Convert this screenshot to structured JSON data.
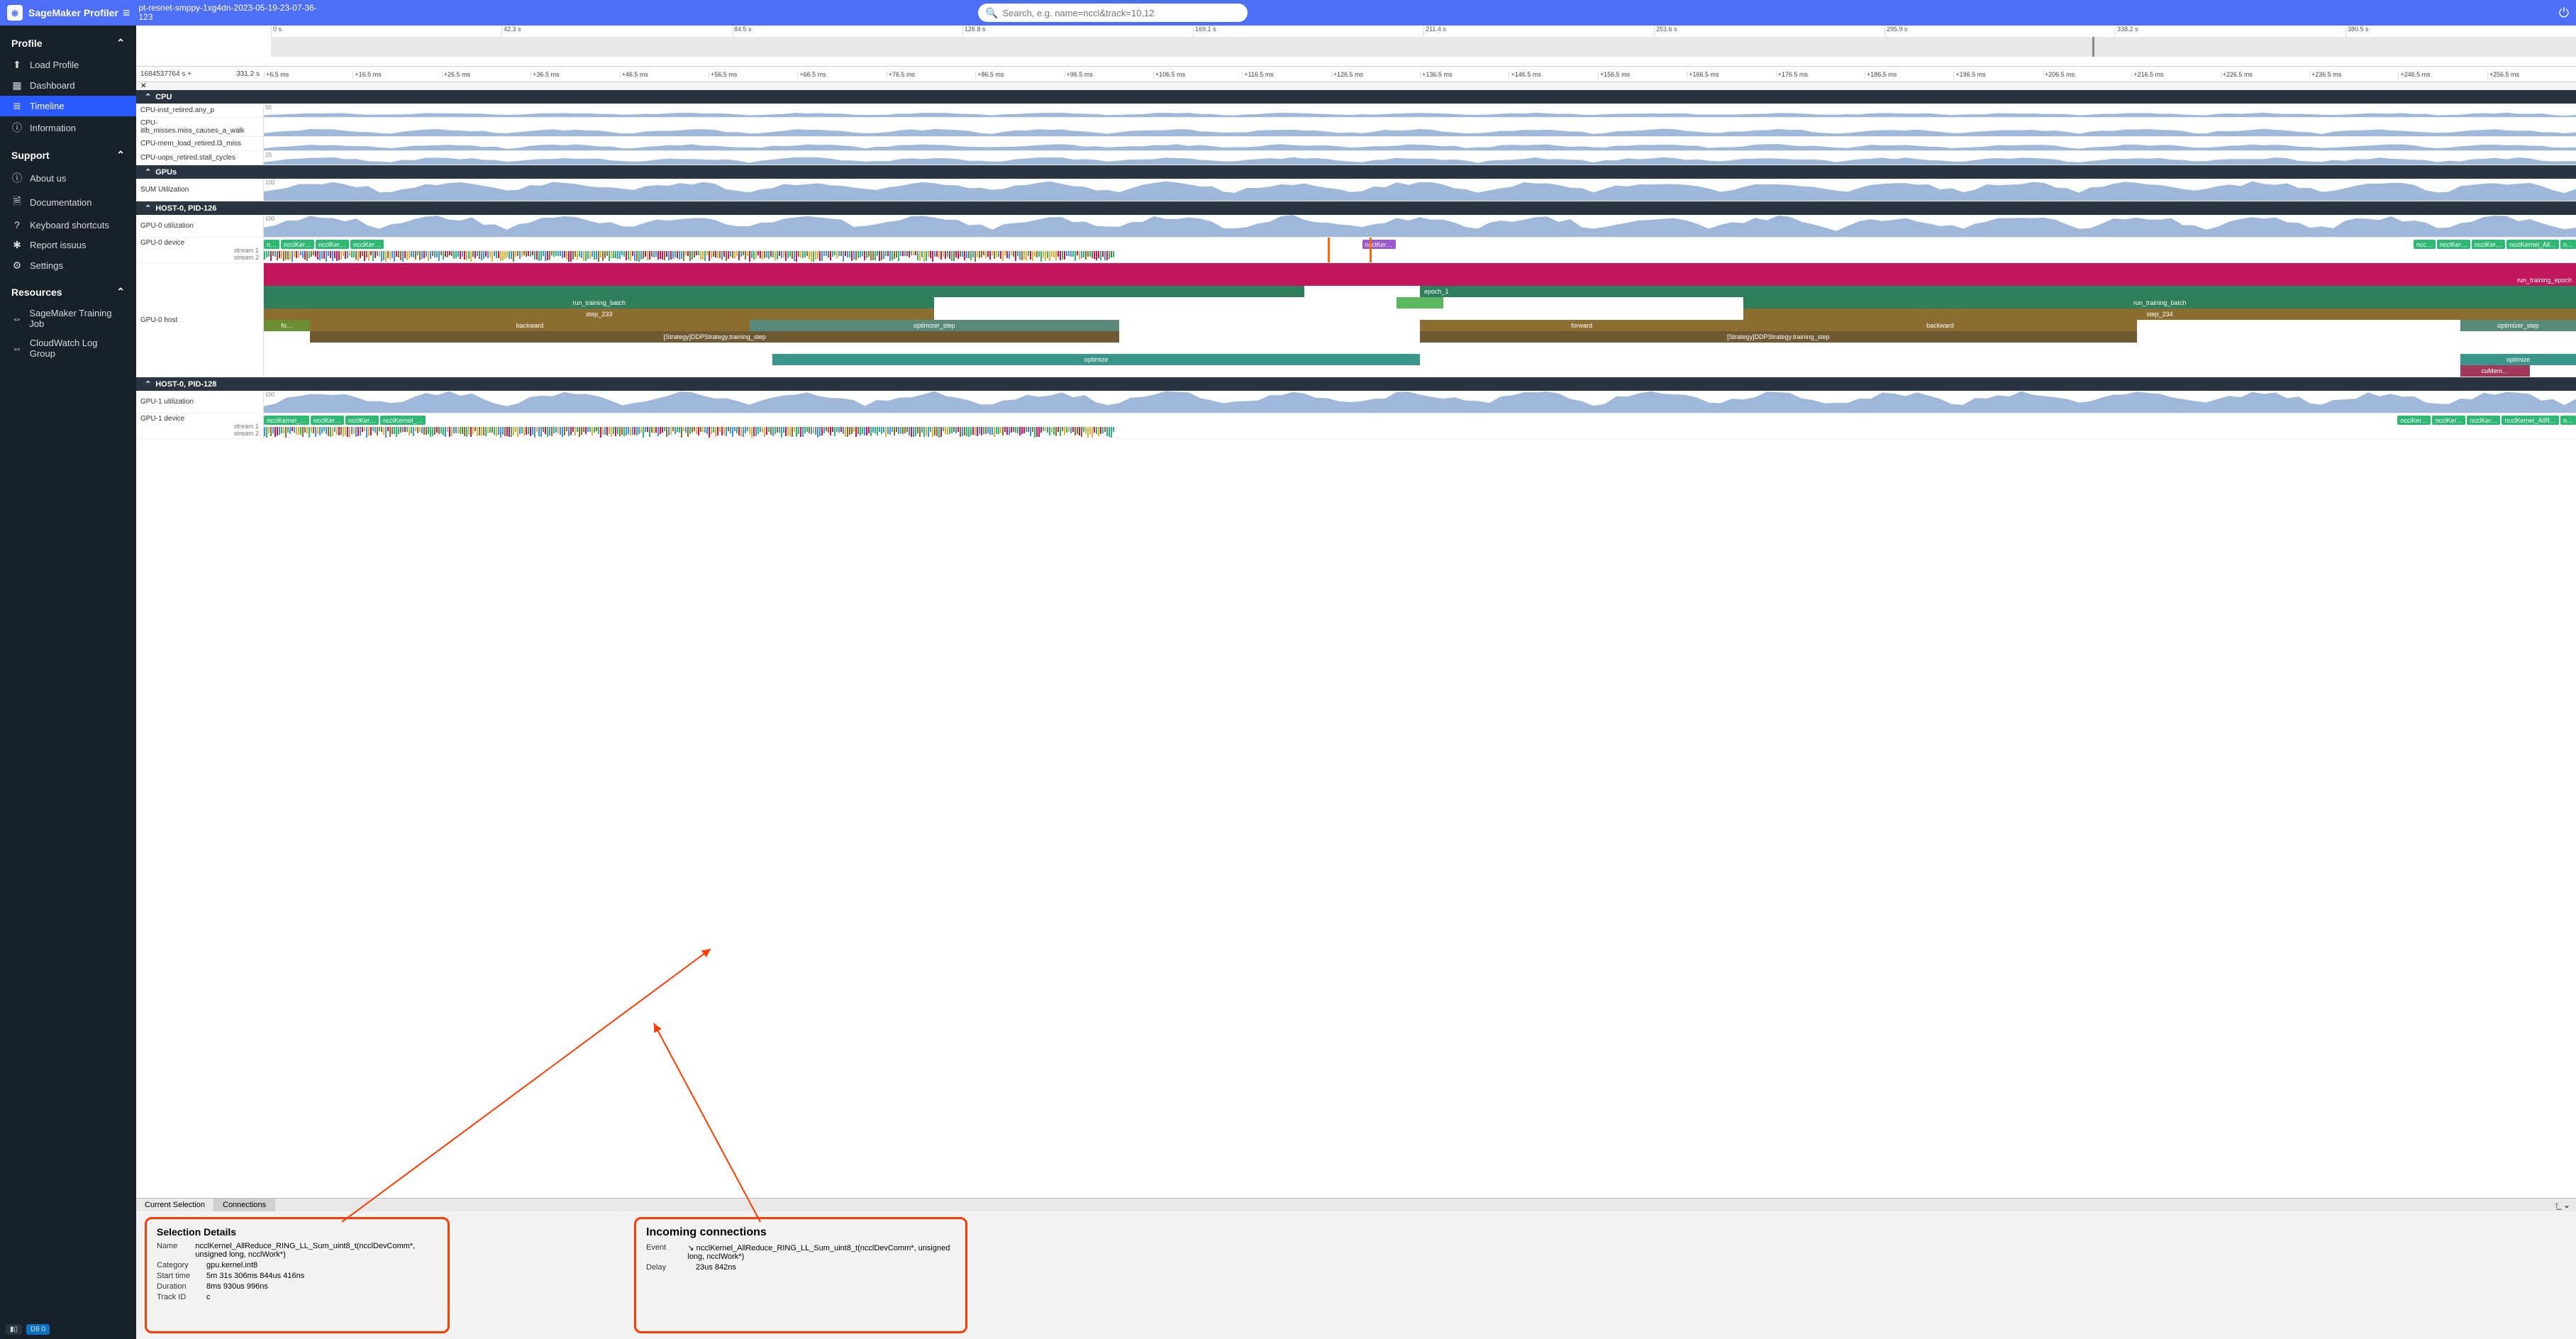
{
  "brand": "SageMaker Profiler",
  "job_name": "pt-resnet-smppy-1xg4dn-2023-05-19-23-07-36-123",
  "search_placeholder": "Search, e.g. name=nccl&track=10,12",
  "sidebar": {
    "profile": {
      "header": "Profile",
      "items": [
        {
          "icon": "⬆",
          "label": "Load Profile"
        },
        {
          "icon": "▦",
          "label": "Dashboard"
        },
        {
          "icon": "≣",
          "label": "Timeline",
          "active": true
        },
        {
          "icon": "ⓘ",
          "label": "Information"
        }
      ]
    },
    "support": {
      "header": "Support",
      "items": [
        {
          "icon": "ⓘ",
          "label": "About us"
        },
        {
          "icon": "🗎",
          "label": "Documentation"
        },
        {
          "icon": "?",
          "label": "Keyboard shortcuts"
        },
        {
          "icon": "✱",
          "label": "Report issuus"
        },
        {
          "icon": "⚙",
          "label": "Settings"
        }
      ]
    },
    "resources": {
      "header": "Resources",
      "items": [
        {
          "icon": "⇔",
          "label": "SageMaker Training Job"
        },
        {
          "icon": "⇔",
          "label": "CloudWatch Log Group"
        }
      ]
    }
  },
  "overview_ticks": [
    "0 s",
    "42.3 s",
    "84.5 s",
    "126.8 s",
    "169.1 s",
    "211.4 s",
    "253.6 s",
    "295.9 s",
    "338.2 s",
    "380.5 s"
  ],
  "time_header": {
    "left_start": "1684537764 s +",
    "left_end": "331.2 s",
    "ticks": [
      "+6.5 ms",
      "+16.5 ms",
      "+26.5 ms",
      "+36.5 ms",
      "+46.5 ms",
      "+56.5 ms",
      "+66.5 ms",
      "+76.5 ms",
      "+86.5 ms",
      "+96.5 ms",
      "+106.5 ms",
      "+116.5 ms",
      "+126.5 ms",
      "+136.5 ms",
      "+146.5 ms",
      "+156.5 ms",
      "+166.5 ms",
      "+176.5 ms",
      "+186.5 ms",
      "+196.5 ms",
      "+206.5 ms",
      "+216.5 ms",
      "+226.5 ms",
      "+236.5 ms",
      "+246.5 ms",
      "+256.5 ms"
    ]
  },
  "groups": {
    "cpu": {
      "title": "CPU",
      "rows": [
        {
          "label": "CPU-inst_retired.any_p",
          "axis": "50"
        },
        {
          "label": "CPU-itlb_misses.miss_causes_a_walk"
        },
        {
          "label": "CPU-mem_load_retired.l3_miss"
        },
        {
          "label": "CPU-uops_retired.stall_cycles",
          "axis": "25"
        }
      ]
    },
    "gpus": {
      "title": "GPUs",
      "sum": {
        "label": "SUM Utilization",
        "axis": "100"
      }
    },
    "host0": {
      "title": "HOST-0, PID-126",
      "util": {
        "label": "GPU-0 utilization",
        "axis": "100"
      },
      "device": {
        "label": "GPU-0 device",
        "streams": [
          "stream 1",
          "stream 2"
        ],
        "kernels_top": [
          "n…",
          "ncclKer…",
          "ncclKer…",
          "ncclKer…"
        ],
        "kernels_top_right": [
          "ncc…",
          "ncclKer…",
          "ncclKer…",
          "ncclKernel_All…",
          "n…"
        ],
        "highlight_kernel": "ncclKer…"
      },
      "host": {
        "label": "GPU-0 host",
        "stack": [
          [
            {
              "w": 100,
              "c": "#c2185b",
              "t": ""
            }
          ],
          [
            {
              "w": 45,
              "c": "#c2185b",
              "t": ""
            },
            {
              "w": 55,
              "c": "#c2185b",
              "t": "run_training_epoch",
              "al": "right"
            }
          ],
          [
            {
              "w": 45,
              "c": "#2e7d5b",
              "t": ""
            },
            {
              "w": 5,
              "c": "transparent",
              "t": ""
            },
            {
              "w": 50,
              "c": "#2e7d5b",
              "t": "epoch_1",
              "al": "left"
            }
          ],
          [
            {
              "w": 29,
              "c": "#2e7d5b",
              "t": "run_training_batch"
            },
            {
              "w": 20,
              "c": "transparent",
              "t": ""
            },
            {
              "w": 2,
              "c": "#5cb85c",
              "t": ""
            },
            {
              "w": 13,
              "c": "transparent",
              "t": ""
            },
            {
              "w": 36,
              "c": "#2e7d5b",
              "t": "run_training_batch"
            }
          ],
          [
            {
              "w": 29,
              "c": "#8d6e32",
              "t": "step_233"
            },
            {
              "w": 35,
              "c": "transparent",
              "t": ""
            },
            {
              "w": 36,
              "c": "#8d6e32",
              "t": "step_234"
            }
          ],
          [
            {
              "w": 2,
              "c": "#6d8d34",
              "t": "fo…"
            },
            {
              "w": 19,
              "c": "#8d6e32",
              "t": "backward"
            },
            {
              "w": 16,
              "c": "#5a8a7a",
              "t": "optimizer_step"
            },
            {
              "w": 13,
              "c": "transparent",
              "t": ""
            },
            {
              "w": 14,
              "c": "#8d6e32",
              "t": "forward"
            },
            {
              "w": 17,
              "c": "#8d6e32",
              "t": "backward"
            },
            {
              "w": 14,
              "c": "transparent",
              "t": ""
            },
            {
              "w": 5,
              "c": "#5a8a7a",
              "t": "optimizer_step"
            }
          ],
          [
            {
              "w": 2,
              "c": "transparent",
              "t": ""
            },
            {
              "w": 35,
              "c": "#6d5a32",
              "t": "[Strategy]DDPStrategy.training_step"
            },
            {
              "w": 13,
              "c": "transparent",
              "t": ""
            },
            {
              "w": 31,
              "c": "#6d5a32",
              "t": "[Strategy]DDPStrategy.training_step"
            },
            {
              "w": 19,
              "c": "transparent",
              "t": ""
            }
          ],
          [
            {
              "w": 100,
              "c": "transparent",
              "t": ""
            }
          ],
          [
            {
              "w": 22,
              "c": "transparent",
              "t": ""
            },
            {
              "w": 28,
              "c": "#3a9688",
              "t": "optimize"
            },
            {
              "w": 45,
              "c": "transparent",
              "t": ""
            },
            {
              "w": 5,
              "c": "#3a9688",
              "t": "optimize"
            }
          ],
          [
            {
              "w": 95,
              "c": "transparent",
              "t": ""
            },
            {
              "w": 3,
              "c": "#a0395c",
              "t": "cuMem…"
            },
            {
              "w": 2,
              "c": "transparent",
              "t": ""
            }
          ]
        ]
      }
    },
    "host1": {
      "title": "HOST-0, PID-128",
      "util": {
        "label": "GPU-1 utilization",
        "axis": "100"
      },
      "device": {
        "label": "GPU-1 device",
        "streams": [
          "stream 1",
          "stream 2"
        ],
        "kernels": [
          "ncclKernel_…",
          "ncclKer…",
          "ncclKer…",
          "ncclKernel_…"
        ],
        "kernels_right": [
          "ncclKer…",
          "ncclKer…",
          "ncclKer…",
          "ncclKernel_AllR…",
          "n…"
        ]
      }
    }
  },
  "shelf": {
    "tabs": [
      "Current Selection",
      "Connections"
    ],
    "selection": {
      "title": "Selection Details",
      "rows": [
        {
          "k": "Name",
          "v": "ncclKernel_AllReduce_RING_LL_Sum_uint8_t(ncclDevComm*, unsigned long, ncclWork*)"
        },
        {
          "k": "Category",
          "v": "gpu.kernel.int8"
        },
        {
          "k": "Start time",
          "v": "5m 31s 306ms 844us 416ns"
        },
        {
          "k": "Duration",
          "v": "8ms 930us 996ns"
        },
        {
          "k": "Track ID",
          "v": "c"
        }
      ]
    },
    "connections": {
      "title": "Incoming connections",
      "rows": [
        {
          "k": "Event",
          "v": "↘ ncclKernel_AllReduce_RING_LL_Sum_uint8_t(ncclDevComm*, unsigned long, ncclWork*)"
        },
        {
          "k": "Delay",
          "v": "23us 842ns"
        }
      ]
    }
  },
  "footer_chips": [
    "▮▯",
    "D8 0"
  ]
}
